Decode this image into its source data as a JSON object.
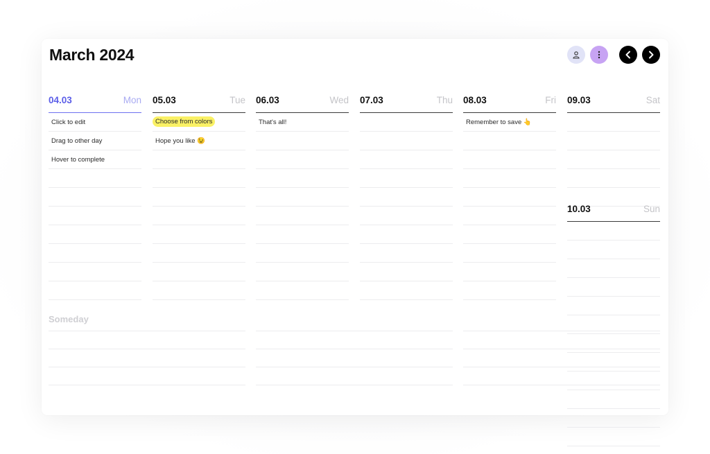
{
  "title": "March 2024",
  "toolbar": {
    "user_icon": "user-icon",
    "menu_icon": "more-vertical-icon",
    "prev_icon": "chevron-left-icon",
    "next_icon": "chevron-right-icon"
  },
  "colors": {
    "today_accent": "#5b5ee8",
    "highlight_yellow": "#faf165",
    "menu_button": "#c7a3f3",
    "user_button": "#e1e3f7"
  },
  "days": [
    {
      "date": "04.03",
      "day": "Mon",
      "today": true,
      "tasks": [
        "Click to edit",
        "Drag to other day",
        "Hover to complete"
      ]
    },
    {
      "date": "05.03",
      "day": "Tue",
      "today": false,
      "tasks": [
        "Choose from colors",
        "Hope you like 😉"
      ],
      "highlight": "Choose from colors"
    },
    {
      "date": "06.03",
      "day": "Wed",
      "today": false,
      "tasks": [
        "That's all!"
      ]
    },
    {
      "date": "07.03",
      "day": "Thu",
      "today": false,
      "tasks": []
    },
    {
      "date": "08.03",
      "day": "Fri",
      "today": false,
      "tasks": [
        "Remember to save 👆"
      ]
    },
    {
      "date": "09.03",
      "day": "Sat",
      "today": false,
      "tasks": []
    },
    {
      "date": "10.03",
      "day": "Sun",
      "today": false,
      "tasks": []
    }
  ],
  "someday": {
    "title": "Someday"
  }
}
